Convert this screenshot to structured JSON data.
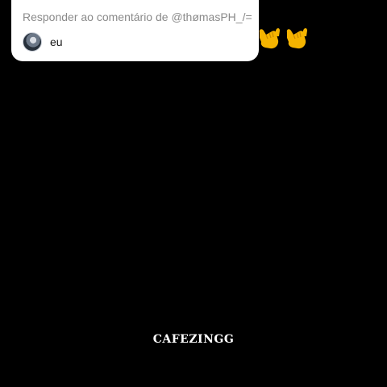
{
  "reply": {
    "header": "Responder ao comentário de @thømasPH_/=",
    "comment_text": "eu",
    "avatar_icon": "user-avatar"
  },
  "emojis": [
    "call-me-hand-icon",
    "call-me-hand-icon"
  ],
  "watermark": "CAFEZINGG",
  "colors": {
    "background": "#000000",
    "card": "#ffffff",
    "header_text": "#8a8a8a",
    "emoji": "#f5b400"
  }
}
